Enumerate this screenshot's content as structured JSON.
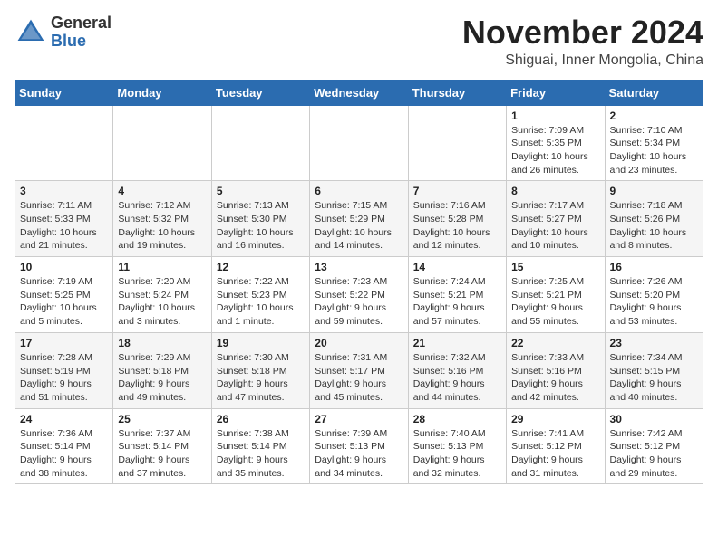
{
  "header": {
    "logo_general": "General",
    "logo_blue": "Blue",
    "month_title": "November 2024",
    "location": "Shiguai, Inner Mongolia, China"
  },
  "weekdays": [
    "Sunday",
    "Monday",
    "Tuesday",
    "Wednesday",
    "Thursday",
    "Friday",
    "Saturday"
  ],
  "weeks": [
    [
      {
        "day": "",
        "info": ""
      },
      {
        "day": "",
        "info": ""
      },
      {
        "day": "",
        "info": ""
      },
      {
        "day": "",
        "info": ""
      },
      {
        "day": "",
        "info": ""
      },
      {
        "day": "1",
        "info": "Sunrise: 7:09 AM\nSunset: 5:35 PM\nDaylight: 10 hours and 26 minutes."
      },
      {
        "day": "2",
        "info": "Sunrise: 7:10 AM\nSunset: 5:34 PM\nDaylight: 10 hours and 23 minutes."
      }
    ],
    [
      {
        "day": "3",
        "info": "Sunrise: 7:11 AM\nSunset: 5:33 PM\nDaylight: 10 hours and 21 minutes."
      },
      {
        "day": "4",
        "info": "Sunrise: 7:12 AM\nSunset: 5:32 PM\nDaylight: 10 hours and 19 minutes."
      },
      {
        "day": "5",
        "info": "Sunrise: 7:13 AM\nSunset: 5:30 PM\nDaylight: 10 hours and 16 minutes."
      },
      {
        "day": "6",
        "info": "Sunrise: 7:15 AM\nSunset: 5:29 PM\nDaylight: 10 hours and 14 minutes."
      },
      {
        "day": "7",
        "info": "Sunrise: 7:16 AM\nSunset: 5:28 PM\nDaylight: 10 hours and 12 minutes."
      },
      {
        "day": "8",
        "info": "Sunrise: 7:17 AM\nSunset: 5:27 PM\nDaylight: 10 hours and 10 minutes."
      },
      {
        "day": "9",
        "info": "Sunrise: 7:18 AM\nSunset: 5:26 PM\nDaylight: 10 hours and 8 minutes."
      }
    ],
    [
      {
        "day": "10",
        "info": "Sunrise: 7:19 AM\nSunset: 5:25 PM\nDaylight: 10 hours and 5 minutes."
      },
      {
        "day": "11",
        "info": "Sunrise: 7:20 AM\nSunset: 5:24 PM\nDaylight: 10 hours and 3 minutes."
      },
      {
        "day": "12",
        "info": "Sunrise: 7:22 AM\nSunset: 5:23 PM\nDaylight: 10 hours and 1 minute."
      },
      {
        "day": "13",
        "info": "Sunrise: 7:23 AM\nSunset: 5:22 PM\nDaylight: 9 hours and 59 minutes."
      },
      {
        "day": "14",
        "info": "Sunrise: 7:24 AM\nSunset: 5:21 PM\nDaylight: 9 hours and 57 minutes."
      },
      {
        "day": "15",
        "info": "Sunrise: 7:25 AM\nSunset: 5:21 PM\nDaylight: 9 hours and 55 minutes."
      },
      {
        "day": "16",
        "info": "Sunrise: 7:26 AM\nSunset: 5:20 PM\nDaylight: 9 hours and 53 minutes."
      }
    ],
    [
      {
        "day": "17",
        "info": "Sunrise: 7:28 AM\nSunset: 5:19 PM\nDaylight: 9 hours and 51 minutes."
      },
      {
        "day": "18",
        "info": "Sunrise: 7:29 AM\nSunset: 5:18 PM\nDaylight: 9 hours and 49 minutes."
      },
      {
        "day": "19",
        "info": "Sunrise: 7:30 AM\nSunset: 5:18 PM\nDaylight: 9 hours and 47 minutes."
      },
      {
        "day": "20",
        "info": "Sunrise: 7:31 AM\nSunset: 5:17 PM\nDaylight: 9 hours and 45 minutes."
      },
      {
        "day": "21",
        "info": "Sunrise: 7:32 AM\nSunset: 5:16 PM\nDaylight: 9 hours and 44 minutes."
      },
      {
        "day": "22",
        "info": "Sunrise: 7:33 AM\nSunset: 5:16 PM\nDaylight: 9 hours and 42 minutes."
      },
      {
        "day": "23",
        "info": "Sunrise: 7:34 AM\nSunset: 5:15 PM\nDaylight: 9 hours and 40 minutes."
      }
    ],
    [
      {
        "day": "24",
        "info": "Sunrise: 7:36 AM\nSunset: 5:14 PM\nDaylight: 9 hours and 38 minutes."
      },
      {
        "day": "25",
        "info": "Sunrise: 7:37 AM\nSunset: 5:14 PM\nDaylight: 9 hours and 37 minutes."
      },
      {
        "day": "26",
        "info": "Sunrise: 7:38 AM\nSunset: 5:14 PM\nDaylight: 9 hours and 35 minutes."
      },
      {
        "day": "27",
        "info": "Sunrise: 7:39 AM\nSunset: 5:13 PM\nDaylight: 9 hours and 34 minutes."
      },
      {
        "day": "28",
        "info": "Sunrise: 7:40 AM\nSunset: 5:13 PM\nDaylight: 9 hours and 32 minutes."
      },
      {
        "day": "29",
        "info": "Sunrise: 7:41 AM\nSunset: 5:12 PM\nDaylight: 9 hours and 31 minutes."
      },
      {
        "day": "30",
        "info": "Sunrise: 7:42 AM\nSunset: 5:12 PM\nDaylight: 9 hours and 29 minutes."
      }
    ]
  ]
}
